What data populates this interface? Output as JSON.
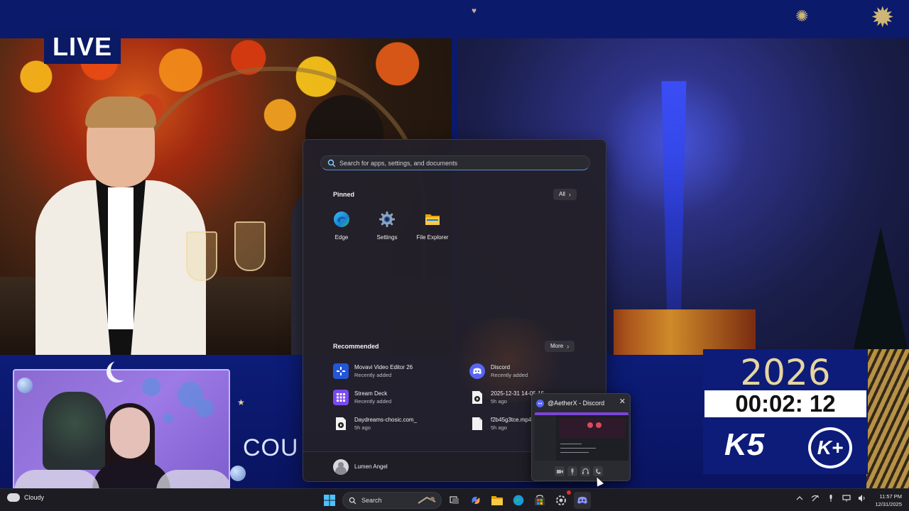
{
  "broadcast": {
    "live_label": "LIVE",
    "lower_text": "COU",
    "countdown_year": "2026",
    "countdown_time": "00:02: 12",
    "logo_k5": "K5",
    "logo_kplus": "K+"
  },
  "start_menu": {
    "search_placeholder": "Search for apps, settings, and documents",
    "pinned_title": "Pinned",
    "all_label": "All",
    "pinned": [
      {
        "label": "Edge",
        "icon": "edge-icon"
      },
      {
        "label": "Settings",
        "icon": "settings-gear-icon"
      },
      {
        "label": "File Explorer",
        "icon": "folder-icon"
      }
    ],
    "recommended_title": "Recommended",
    "more_label": "More",
    "recommended": [
      {
        "title": "Movavi Video Editor 26",
        "sub": "Recently added",
        "icon": "movavi-icon"
      },
      {
        "title": "Discord",
        "sub": "Recently added",
        "icon": "discord-icon"
      },
      {
        "title": "Stream Deck",
        "sub": "Recently added",
        "icon": "stream-deck-icon"
      },
      {
        "title": "2025-12-31 14-05-15",
        "sub": "5h ago",
        "icon": "video-file-icon"
      },
      {
        "title": "Daydreams-chosic.com_",
        "sub": "5h ago",
        "icon": "audio-file-icon"
      },
      {
        "title": "f2b45g3tce.mp4",
        "sub": "5h ago",
        "icon": "file-icon"
      }
    ],
    "user_name": "Lumen Angel"
  },
  "discord_preview": {
    "title": "@AetherX - Discord"
  },
  "taskbar": {
    "weather_text": "Cloudy",
    "search_label": "Search",
    "time": "11:57 PM",
    "date": "12/31/2025"
  },
  "colors": {
    "accent": "#5a8ad8",
    "broadcast_blue": "#0c1c78",
    "discord": "#5865f2",
    "start_bg": "#23202a"
  }
}
